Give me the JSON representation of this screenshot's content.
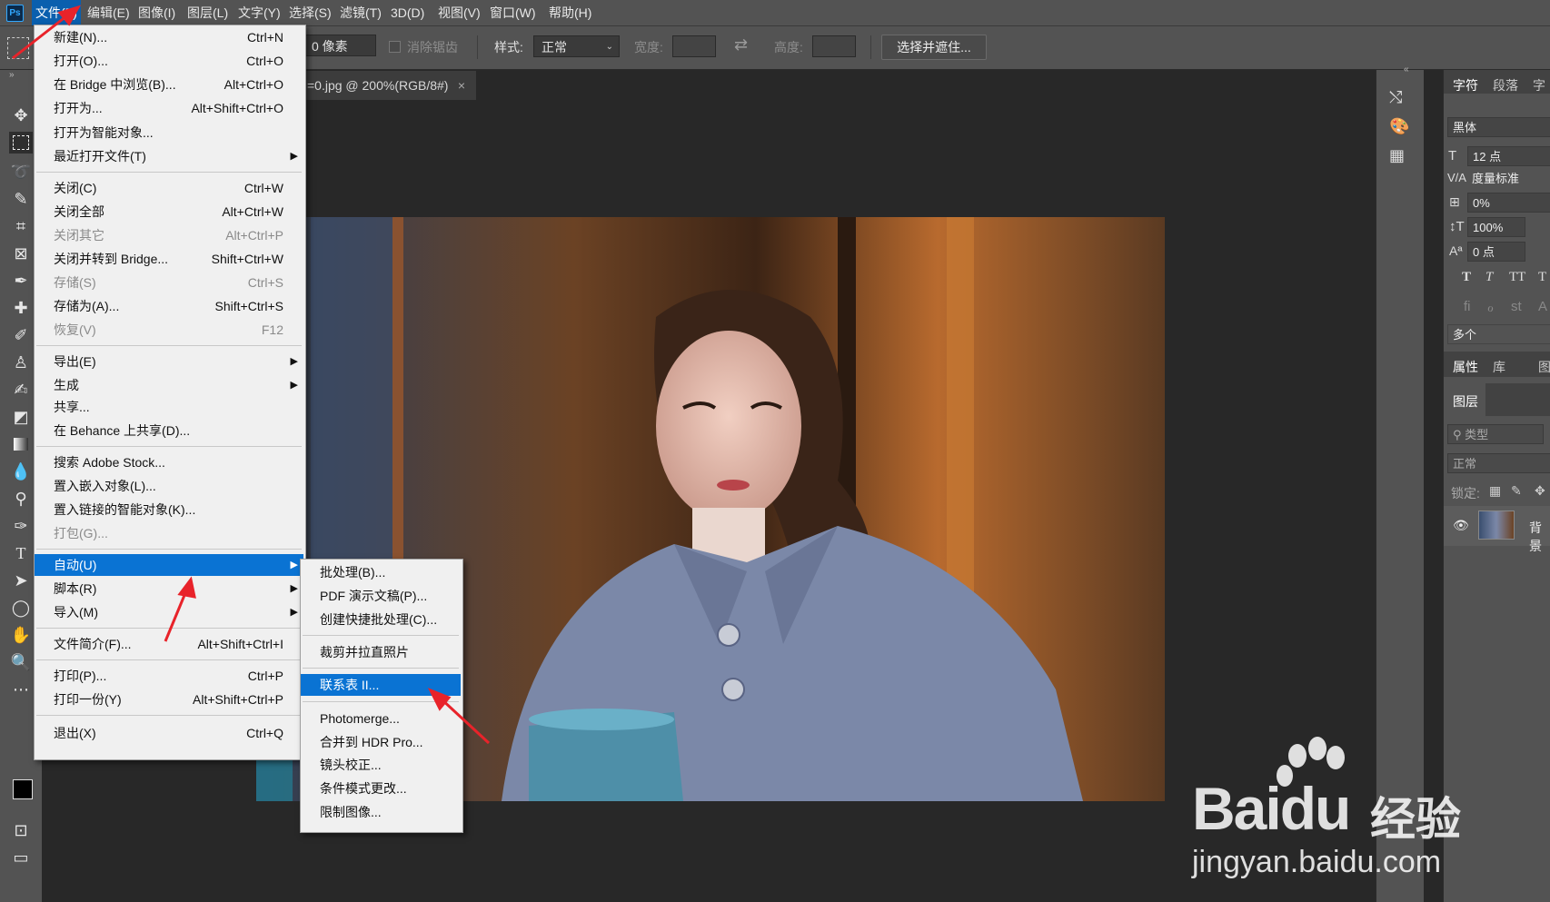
{
  "app": {
    "logo_text": "Ps"
  },
  "menubar": {
    "items": [
      "文件(F)",
      "编辑(E)",
      "图像(I)",
      "图层(L)",
      "文字(Y)",
      "选择(S)",
      "滤镜(T)",
      "3D(D)",
      "视图(V)",
      "窗口(W)",
      "帮助(H)"
    ]
  },
  "options_bar": {
    "feather_value": "0 像素",
    "antialias_label": "消除锯齿",
    "style_label": "样式:",
    "style_value": "正常",
    "width_label": "宽度:",
    "height_label": "高度:",
    "select_mask_button": "选择并遮住..."
  },
  "document_tab": {
    "title": "=0.jpg @ 200%(RGB/8#)",
    "close": "×"
  },
  "file_menu": {
    "items": [
      {
        "label": "新建(N)...",
        "shortcut": "Ctrl+N"
      },
      {
        "label": "打开(O)...",
        "shortcut": "Ctrl+O"
      },
      {
        "label": "在 Bridge 中浏览(B)...",
        "shortcut": "Alt+Ctrl+O"
      },
      {
        "label": "打开为...",
        "shortcut": "Alt+Shift+Ctrl+O"
      },
      {
        "label": "打开为智能对象...",
        "shortcut": ""
      },
      {
        "label": "最近打开文件(T)",
        "shortcut": "",
        "submenu": true
      },
      {
        "label": "关闭(C)",
        "shortcut": "Ctrl+W"
      },
      {
        "label": "关闭全部",
        "shortcut": "Alt+Ctrl+W"
      },
      {
        "label": "关闭其它",
        "shortcut": "Alt+Ctrl+P",
        "disabled": true
      },
      {
        "label": "关闭并转到 Bridge...",
        "shortcut": "Shift+Ctrl+W"
      },
      {
        "label": "存储(S)",
        "shortcut": "Ctrl+S",
        "disabled": true
      },
      {
        "label": "存储为(A)...",
        "shortcut": "Shift+Ctrl+S"
      },
      {
        "label": "恢复(V)",
        "shortcut": "F12",
        "disabled": true
      },
      {
        "label": "导出(E)",
        "shortcut": "",
        "submenu": true
      },
      {
        "label": "生成",
        "shortcut": "",
        "submenu": true
      },
      {
        "label": "共享...",
        "shortcut": ""
      },
      {
        "label": "在 Behance 上共享(D)...",
        "shortcut": ""
      },
      {
        "label": "搜索 Adobe Stock...",
        "shortcut": ""
      },
      {
        "label": "置入嵌入对象(L)...",
        "shortcut": ""
      },
      {
        "label": "置入链接的智能对象(K)...",
        "shortcut": ""
      },
      {
        "label": "打包(G)...",
        "shortcut": "",
        "disabled": true
      },
      {
        "label": "自动(U)",
        "shortcut": "",
        "submenu": true,
        "highlighted": true
      },
      {
        "label": "脚本(R)",
        "shortcut": "",
        "submenu": true
      },
      {
        "label": "导入(M)",
        "shortcut": "",
        "submenu": true
      },
      {
        "label": "文件简介(F)...",
        "shortcut": "Alt+Shift+Ctrl+I"
      },
      {
        "label": "打印(P)...",
        "shortcut": "Ctrl+P"
      },
      {
        "label": "打印一份(Y)",
        "shortcut": "Alt+Shift+Ctrl+P"
      },
      {
        "label": "退出(X)",
        "shortcut": "Ctrl+Q"
      }
    ]
  },
  "automate_submenu": {
    "items": [
      {
        "label": "批处理(B)..."
      },
      {
        "label": "PDF 演示文稿(P)..."
      },
      {
        "label": "创建快捷批处理(C)..."
      },
      {
        "label": "裁剪并拉直照片"
      },
      {
        "label": "联系表 II...",
        "highlighted": true
      },
      {
        "label": "Photomerge..."
      },
      {
        "label": "合并到 HDR Pro..."
      },
      {
        "label": "镜头校正..."
      },
      {
        "label": "条件模式更改..."
      },
      {
        "label": "限制图像..."
      }
    ]
  },
  "character_panel": {
    "tabs": [
      "字符",
      "段落",
      "字"
    ],
    "font": "黑体",
    "size": "12 点",
    "kerning": "度量标准",
    "tracking": "0%",
    "vscale": "100%",
    "baseline": "0 点",
    "style_buttons": [
      "T",
      "T",
      "TT",
      "T"
    ],
    "opentype_buttons": [
      "fi",
      "ℴ",
      "st",
      "A"
    ],
    "language": "多个"
  },
  "properties_panel": {
    "tabs": [
      "属性",
      "库",
      "图"
    ]
  },
  "layers_panel": {
    "tab": "图层",
    "filter_placeholder": "类型",
    "blend_mode": "正常",
    "lock_label": "锁定:",
    "layer_name": "背景"
  },
  "watermark": {
    "brand": "Baidu",
    "brand_cn": "经验",
    "url": "jingyan.baidu.com"
  },
  "colors": {
    "accent": "#0a73d3",
    "annotation": "#e8232a",
    "chrome": "#535353"
  }
}
